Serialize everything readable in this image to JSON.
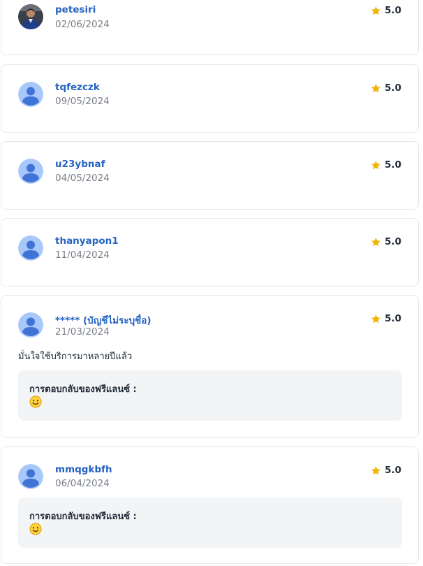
{
  "reviews": [
    {
      "username": "petesiri",
      "date": "02/06/2024",
      "rating": "5.0",
      "avatar": "user-photo"
    },
    {
      "username": "tqfezczk",
      "date": "09/05/2024",
      "rating": "5.0",
      "avatar": "default-avatar-icon"
    },
    {
      "username": "u23ybnaf",
      "date": "04/05/2024",
      "rating": "5.0",
      "avatar": "default-avatar-icon"
    },
    {
      "username": "thanyapon1",
      "date": "11/04/2024",
      "rating": "5.0",
      "avatar": "default-avatar-icon"
    },
    {
      "username": "***** (บัญชีไม่ระบุชื่อ)",
      "date": "21/03/2024",
      "rating": "5.0",
      "avatar": "default-avatar-icon",
      "comment": "มั่นใจใช้บริการมาหลายปีแล้ว",
      "reply": {
        "label": "การตอบกลับของฟรีแลนซ์ :",
        "emoji": "smiling-face-icon"
      }
    },
    {
      "username": "mmqgkbfh",
      "date": "06/04/2024",
      "rating": "5.0",
      "avatar": "default-avatar-icon",
      "reply": {
        "label": "การตอบกลับของฟรีแลนซ์ :",
        "emoji": "smiling-face-icon"
      }
    }
  ],
  "colors": {
    "username": "#2563c2",
    "date": "#7a7f87",
    "star": "#f0b400",
    "card_border": "#e5e7eb",
    "reply_bg": "#f3f4f6",
    "avatar_bg": "#a8c7fa",
    "avatar_fg": "#3f74d6"
  }
}
